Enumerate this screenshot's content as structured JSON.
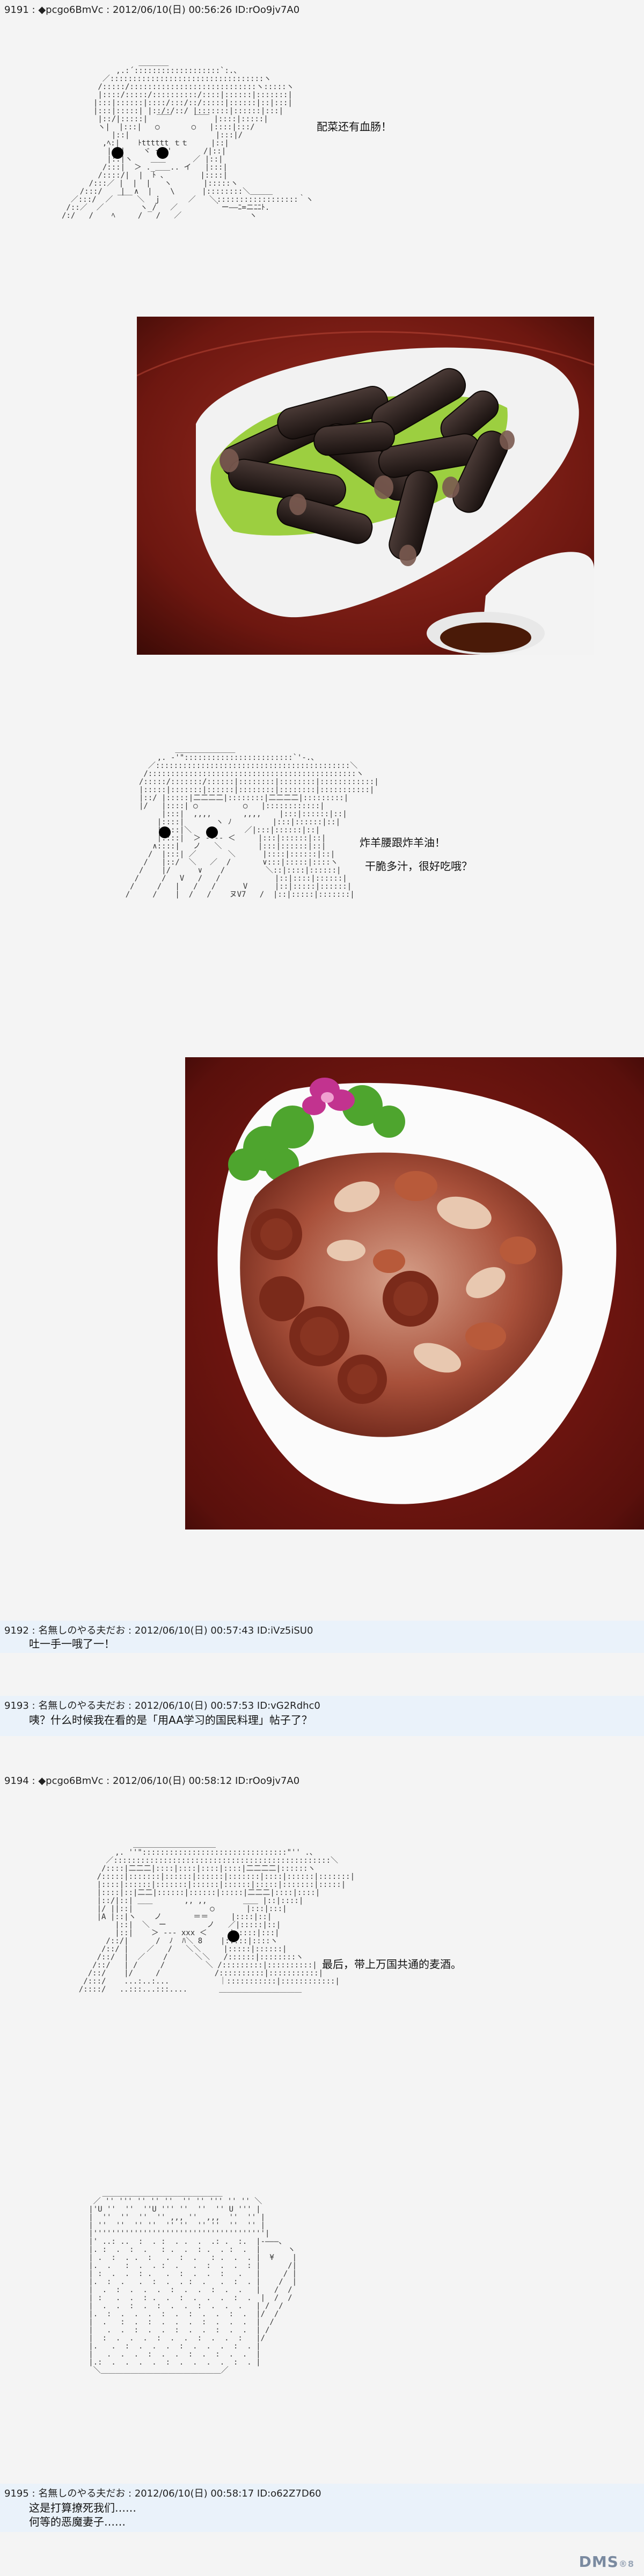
{
  "posts": [
    {
      "header": "9191 : ◆pcgo6BmVc : 2012/06/10(日) 00:56:26 ID:rOo9jv7A0"
    },
    {
      "header": "9192 : 名無しのやる夫だお : 2012/06/10(日) 00:57:43 ID:iVz5iSU0",
      "lines": [
        "吐一手一哦了一！"
      ]
    },
    {
      "header": "9193 : 名無しのやる夫だお : 2012/06/10(日) 00:57:53 ID:vG2Rdhc0",
      "lines": [
        "咦？什么时候我在看的是「用AA学习的国民料理」帖子了？"
      ]
    },
    {
      "header": "9194 : ◆pcgo6BmVc : 2012/06/10(日) 00:58:12 ID:rOo9jv7A0"
    },
    {
      "header": "9195 : 名無しのやる夫だお : 2012/06/10(日) 00:58:17 ID:o62Z7D60",
      "lines": [
        "这是打算撩死我们……",
        "何等的恶魔妻子……"
      ]
    }
  ],
  "dialogs": {
    "d1": "配菜还有血肠！",
    "d2a": "炸羊腰跟炸羊油！",
    "d2b": "干脆多汁，很好吃哦？",
    "d3": "最后，带上万国共通的麦酒。"
  },
  "watermark": {
    "main": "DMS",
    "sub": "®8"
  },
  "colors": {
    "reply_band": "#eaf2fa",
    "plate": "#f6f6f6",
    "table": "#7a1a14"
  }
}
